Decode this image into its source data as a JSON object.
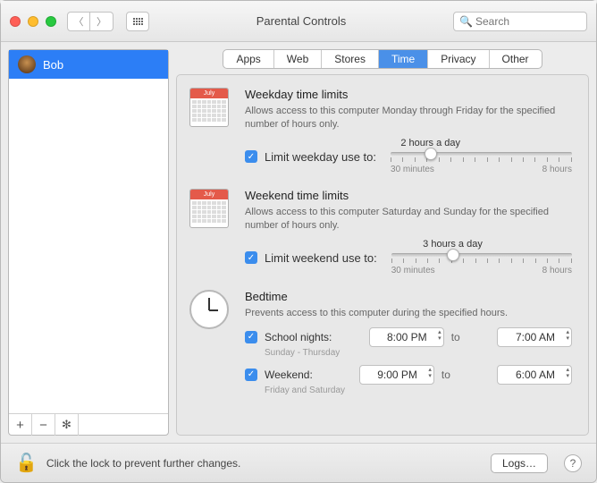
{
  "window": {
    "title": "Parental Controls"
  },
  "search": {
    "placeholder": "Search"
  },
  "sidebar": {
    "users": [
      {
        "name": "Bob"
      }
    ]
  },
  "tabs": [
    "Apps",
    "Web",
    "Stores",
    "Time",
    "Privacy",
    "Other"
  ],
  "activeTab": "Time",
  "weekday": {
    "title": "Weekday time limits",
    "desc": "Allows access to this computer Monday through Friday for the specified number of hours only.",
    "checkLabel": "Limit weekday use to:",
    "valueLabel": "2 hours a day",
    "min": "30 minutes",
    "max": "8 hours",
    "calMonth": "July"
  },
  "weekend": {
    "title": "Weekend time limits",
    "desc": "Allows access to this computer Saturday and Sunday for the specified number of hours only.",
    "checkLabel": "Limit weekend use to:",
    "valueLabel": "3 hours a day",
    "min": "30 minutes",
    "max": "8 hours",
    "calMonth": "July"
  },
  "bedtime": {
    "title": "Bedtime",
    "desc": "Prevents access to this computer during the specified hours.",
    "school": {
      "label": "School nights:",
      "sub": "Sunday - Thursday",
      "from": "8:00 PM",
      "to": "7:00 AM"
    },
    "weekend": {
      "label": "Weekend:",
      "sub": "Friday and Saturday",
      "from": "9:00 PM",
      "to": "6:00 AM"
    },
    "toWord": "to"
  },
  "footer": {
    "lockText": "Click the lock to prevent further changes.",
    "logs": "Logs…",
    "help": "?"
  }
}
